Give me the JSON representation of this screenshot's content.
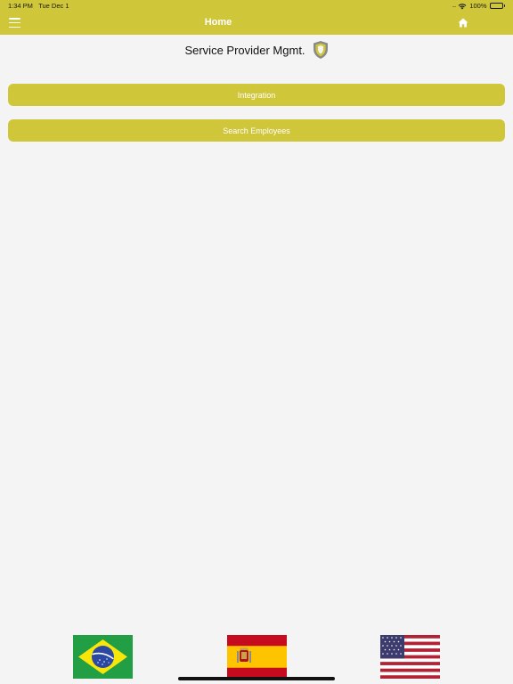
{
  "status_bar": {
    "time": "1:34 PM",
    "date": "Tue Dec 1",
    "signal": "....",
    "battery": "100%"
  },
  "nav_bar": {
    "title": "Home",
    "menu_icon": "hamburger-icon",
    "home_icon": "home-icon"
  },
  "header": {
    "title": "Service Provider Mgmt.",
    "logo_icon": "shield-icon"
  },
  "buttons": {
    "integration": "Integration",
    "search_employees": "Search Employees"
  },
  "languages": {
    "flags": [
      "brazil-flag-icon",
      "spain-flag-icon",
      "usa-flag-icon"
    ]
  },
  "colors": {
    "accent": "#cfc63a",
    "background": "#f4f4f4",
    "button_text": "#ffffff"
  }
}
